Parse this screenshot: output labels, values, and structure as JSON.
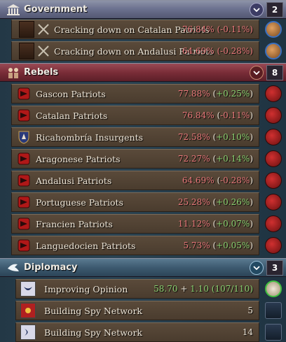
{
  "government": {
    "title": "Government",
    "count": "2",
    "items": [
      {
        "label": "Cracking down on Catalan Patriots",
        "value": "76.84%",
        "change": "(-0.11%)"
      },
      {
        "label": "Cracking down on Andalusi Patriots",
        "value": "64.69%",
        "change": "(-0.28%)"
      }
    ]
  },
  "rebels": {
    "title": "Rebels",
    "count": "8",
    "items": [
      {
        "label": "Gascon Patriots",
        "value": "77.88%",
        "change": "(+0.25%)",
        "icon": "rebel-flag-icon"
      },
      {
        "label": "Catalan Patriots",
        "value": "76.84%",
        "change": "(-0.11%)",
        "icon": "rebel-flag-icon"
      },
      {
        "label": "Ricahombría Insurgents",
        "value": "72.58%",
        "change": "(+0.10%)",
        "icon": "noble-crest-icon"
      },
      {
        "label": "Aragonese Patriots",
        "value": "72.27%",
        "change": "(+0.14%)",
        "icon": "rebel-flag-icon"
      },
      {
        "label": "Andalusi Patriots",
        "value": "64.69%",
        "change": "(-0.28%)",
        "icon": "rebel-flag-icon"
      },
      {
        "label": "Portuguese Patriots",
        "value": "25.28%",
        "change": "(+0.26%)",
        "icon": "rebel-flag-icon"
      },
      {
        "label": "Francien Patriots",
        "value": "11.12%",
        "change": "(+0.07%)",
        "icon": "rebel-flag-icon"
      },
      {
        "label": "Languedocien Patriots",
        "value": "5.73%",
        "change": "(+0.05%)",
        "icon": "rebel-flag-icon"
      }
    ]
  },
  "diplomacy": {
    "title": "Diplomacy",
    "count": "3",
    "items": [
      {
        "label": "Improving Opinion",
        "value_a": "58.70",
        "op": "+",
        "value_b": "1.10",
        "total": "(107/110)"
      },
      {
        "label": "Building Spy Network",
        "value": "5"
      },
      {
        "label": "Building Spy Network",
        "value": "14"
      }
    ]
  },
  "colors": {
    "negative": "#e8787a",
    "positive": "#8ad070",
    "government_header": "#6d7290",
    "rebels_header": "#7a2d38",
    "diplomacy_header": "#3d5a70"
  }
}
